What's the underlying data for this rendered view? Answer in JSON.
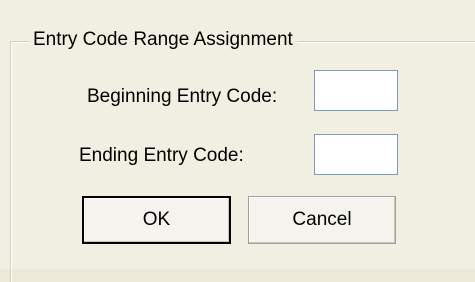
{
  "dialog": {
    "group_title": "Entry Code Range Assignment",
    "beginning_label": "Beginning Entry Code:",
    "beginning_value": "",
    "ending_label": "Ending Entry Code:",
    "ending_value": "",
    "ok_label": "OK",
    "cancel_label": "Cancel",
    "default_button": "OK"
  },
  "colors": {
    "dialog_background": "#f1efe2",
    "groupbox_border": "#d0d0bf",
    "input_border": "#7f9db9",
    "input_background": "#ffffff",
    "default_button_border": "#000000"
  }
}
